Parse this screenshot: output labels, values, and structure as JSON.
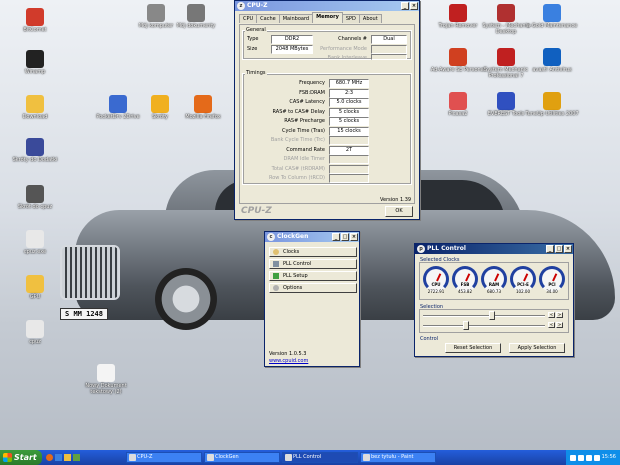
{
  "desktop_icons": [
    {
      "label": "BitComet",
      "color": "#d13b2b"
    },
    {
      "label": "Winamp",
      "color": "#222"
    },
    {
      "label": "Download",
      "color": "#f0c040"
    },
    {
      "label": "Skróty do Dodatki",
      "color": "#3a4a9a"
    },
    {
      "label": "Skrót do cpuz",
      "color": "#555"
    },
    {
      "label": "cpuz.exe",
      "color": "#e8e8e8"
    },
    {
      "label": "GPU",
      "color": "#f0c040"
    },
    {
      "label": "cpuz",
      "color": "#e8e8e8"
    },
    {
      "label": "Mój komputer",
      "color": "#888"
    },
    {
      "label": "Mój dokumenty",
      "color": "#777"
    },
    {
      "label": "PocketDrv 2Drive",
      "color": "#3a6ad0"
    },
    {
      "label": "Skrótу",
      "color": "#f0b020"
    },
    {
      "label": "Mozilla Firefox",
      "color": "#e46a1a"
    },
    {
      "label": "Nowy Dokument tekstowy (2)",
      "color": "#f4f4f4"
    },
    {
      "label": "Trojan Remover",
      "color": "#c02020"
    },
    {
      "label": "System - Mechanic Desktop",
      "color": "#b03030"
    },
    {
      "label": "Ad-Aware SE Personal",
      "color": "#d04020"
    },
    {
      "label": "System Mechanic Professional 7",
      "color": "#c02020"
    },
    {
      "label": "Picasa2",
      "color": "#e05050"
    },
    {
      "label": "EVEREST Tools",
      "color": "#3050c0"
    },
    {
      "label": "a-Gold Maintenance",
      "color": "#3a80e0"
    },
    {
      "label": "avast! Antivirus",
      "color": "#1060c0"
    },
    {
      "label": "TuneUp Utilities 2007",
      "color": "#e0a010"
    }
  ],
  "car": {
    "plate": "S MM 1248"
  },
  "cpuz": {
    "title": "CPU-Z",
    "tabs": [
      "CPU",
      "Cache",
      "Mainboard",
      "Memory",
      "SPD",
      "About"
    ],
    "active_tab": "Memory",
    "general": {
      "legend": "General",
      "type_label": "Type",
      "type": "DDR2",
      "size_label": "Size",
      "size": "2048 MBytes",
      "channels_label": "Channels #",
      "channels": "Dual",
      "perf_label": "Performance Mode",
      "bank_label": "Bank Interleave"
    },
    "timings": {
      "legend": "Timings",
      "rows": [
        {
          "label": "Frequency",
          "value": "680.7 MHz",
          "enabled": true
        },
        {
          "label": "FSB:DRAM",
          "value": "2:3",
          "enabled": true
        },
        {
          "label": "CAS# Latency",
          "value": "5.0 clocks",
          "enabled": true
        },
        {
          "label": "RAS# to CAS# Delay",
          "value": "5 clocks",
          "enabled": true
        },
        {
          "label": "RAS# Precharge",
          "value": "5 clocks",
          "enabled": true
        },
        {
          "label": "Cycle Time (Tras)",
          "value": "15 clocks",
          "enabled": true
        },
        {
          "label": "Bank Cycle Time (Trc)",
          "value": "",
          "enabled": false
        },
        {
          "label": "Command Rate",
          "value": "2T",
          "enabled": true
        },
        {
          "label": "DRAM Idle Timer",
          "value": "",
          "enabled": false
        },
        {
          "label": "Total CAS# (tRDRAM)",
          "value": "",
          "enabled": false
        },
        {
          "label": "Row To Column (tRCD)",
          "value": "",
          "enabled": false
        }
      ]
    },
    "version": "Version 1.39",
    "logo": "CPU-Z",
    "ok_label": "OK"
  },
  "clockgen": {
    "title": "ClockGen",
    "menu": [
      "Clocks",
      "PLL Control",
      "PLL Setup",
      "Options"
    ],
    "version": "Version 1.0.5.3",
    "link": "www.cpuid.com"
  },
  "pll": {
    "title": "PLL Control",
    "selected_clocks_label": "Selected Clocks",
    "clocks": [
      {
        "name": "CPU",
        "value": "2722.91"
      },
      {
        "name": "FSB",
        "value": "453.82"
      },
      {
        "name": "RAM",
        "value": "680.73"
      },
      {
        "name": "PCI-E",
        "value": "102.00"
      },
      {
        "name": "PCI",
        "value": "34.00"
      }
    ],
    "selection_label": "Selection",
    "control_label": "Control",
    "reset_label": "Reset Selection",
    "apply_label": "Apply Selection"
  },
  "taskbar": {
    "start": "Start",
    "items": [
      "CPU-Z",
      "ClockGen",
      "PLL Control",
      "bez tytułu - Paint"
    ],
    "active_item": "PLL Control",
    "clock": "15:56"
  }
}
